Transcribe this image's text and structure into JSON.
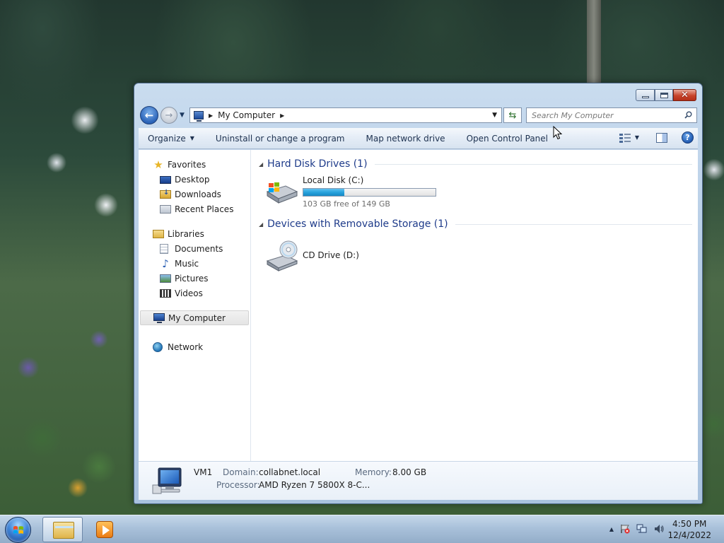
{
  "window": {
    "breadcrumb": [
      "My Computer"
    ],
    "search_placeholder": "Search My Computer"
  },
  "command_bar": {
    "organize": "Organize",
    "uninstall": "Uninstall or change a program",
    "map_drive": "Map network drive",
    "control_panel": "Open Control Panel"
  },
  "nav_pane": {
    "favorites": {
      "label": "Favorites",
      "items": [
        {
          "label": "Desktop",
          "icon": "desktop-icon"
        },
        {
          "label": "Downloads",
          "icon": "downloads-icon"
        },
        {
          "label": "Recent Places",
          "icon": "recent-places-icon"
        }
      ]
    },
    "libraries": {
      "label": "Libraries",
      "items": [
        {
          "label": "Documents",
          "icon": "documents-icon"
        },
        {
          "label": "Music",
          "icon": "music-icon"
        },
        {
          "label": "Pictures",
          "icon": "pictures-icon"
        },
        {
          "label": "Videos",
          "icon": "videos-icon"
        }
      ]
    },
    "computer": {
      "label": "My Computer",
      "selected": true
    },
    "network": {
      "label": "Network"
    }
  },
  "groups": [
    {
      "title": "Hard Disk Drives (1)",
      "items": [
        {
          "name": "Local Disk (C:)",
          "free_text": "103 GB free of 149 GB",
          "used_fraction": 0.309
        }
      ]
    },
    {
      "title": "Devices with Removable Storage (1)",
      "items": [
        {
          "name": "CD Drive (D:)"
        }
      ]
    }
  ],
  "details": {
    "name": "VM1",
    "domain_label": "Domain:",
    "domain": "collabnet.local",
    "memory_label": "Memory:",
    "memory": "8.00 GB",
    "processor_label": "Processor:",
    "processor": "AMD Ryzen 7 5800X 8-C..."
  },
  "taskbar": {
    "time": "4:50 PM",
    "date": "12/4/2022"
  },
  "colors": {
    "accent": "#1e3b8a",
    "bar_fill": "#27a2dc",
    "close_button": "#c8442b"
  }
}
